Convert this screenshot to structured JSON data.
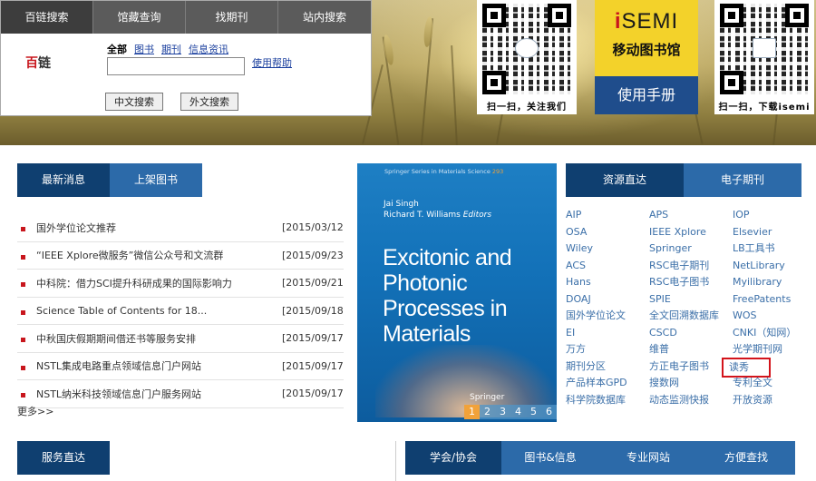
{
  "search": {
    "tabs": [
      "百链搜索",
      "馆藏查询",
      "找期刊",
      "站内搜索"
    ],
    "brand_red": "百",
    "brand_rest": "链",
    "types": [
      "全部",
      "图书",
      "期刊",
      "信息资讯"
    ],
    "help": "使用帮助",
    "btn_cn": "中文搜索",
    "btn_en": "外文搜索",
    "input_value": ""
  },
  "promo": {
    "qr1_caption": "扫一扫，关注我们",
    "app_logo_i": "i",
    "app_logo_rest": "SEMI",
    "app_name": "移动图书馆",
    "app_manual": "使用手册",
    "qr3_caption": "扫一扫，下载isemi"
  },
  "news": {
    "tabs": [
      "最新消息",
      "上架图书"
    ],
    "items": [
      {
        "title": "国外学位论文推荐",
        "date": "[2015/03/12]"
      },
      {
        "title": "“IEEE Xplore微服务”微信公众号和文流群",
        "date": "[2015/09/23]"
      },
      {
        "title": "中科院：借力SCI提升科研成果的国际影响力",
        "date": "[2015/09/21]"
      },
      {
        "title": "Science Table of Contents for 18...",
        "date": "[2015/09/18]"
      },
      {
        "title": "中秋国庆假期期间借还书等服务安排",
        "date": "[2015/09/17]"
      },
      {
        "title": "NSTL集成电路重点领域信息门户网站",
        "date": "[2015/09/17]"
      },
      {
        "title": "NSTL纳米科技领域信息门户服务网站",
        "date": "[2015/09/17]"
      }
    ],
    "more": "更多>>"
  },
  "book": {
    "series": "Springer Series in Materials Science",
    "series_num": "293",
    "author1": "Jai Singh",
    "author2": "Richard T. Williams",
    "editors": "Editors",
    "title": "Excitonic and Photonic Processes in Materials",
    "publisher": "Springer",
    "pages": [
      "1",
      "2",
      "3",
      "4",
      "5",
      "6"
    ],
    "active_page": 1
  },
  "resources": {
    "tabs": [
      "资源直达",
      "电子期刊"
    ],
    "links": [
      "AIP",
      "APS",
      "IOP",
      "OSA",
      "IEEE Xplore",
      "Elsevier",
      "Wiley",
      "Springer",
      "LB工具书",
      "ACS",
      "RSC电子期刊",
      "NetLibrary",
      "Hans",
      "RSC电子图书",
      "Myilibrary",
      "DOAJ",
      "SPIE",
      "FreePatents",
      "国外学位论文",
      "全文回溯数据库",
      "WOS",
      "EI",
      "CSCD",
      "CNKI（知网）",
      "万方",
      "维普",
      "光学期刊网",
      "期刊分区",
      "方正电子图书",
      "读秀",
      "产品样本GPD",
      "搜数网",
      "专利全文",
      "科学院数据库",
      "动态监测快报",
      "开放资源"
    ],
    "boxed_link": "读秀"
  },
  "service_tab": "服务直达",
  "bottom_tabs": [
    "学会/协会",
    "图书&信息",
    "专业网站",
    "方便查找"
  ],
  "colors": {
    "tab_active": "#0f3f70",
    "tab_inactive": "#2c6aa9",
    "link": "#3b6fa8",
    "bullet": "#c8161d",
    "highlight_box": "#d3141b",
    "app_yellow": "#f3d22a"
  }
}
